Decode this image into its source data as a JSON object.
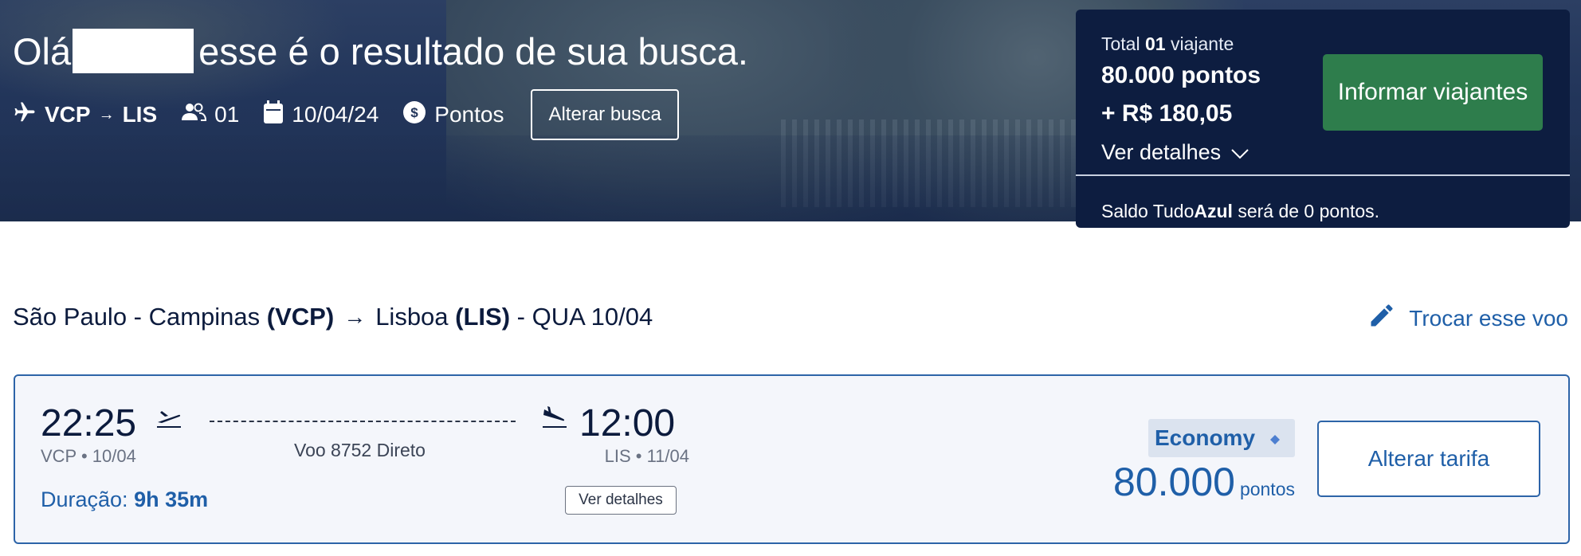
{
  "hero": {
    "greeting_prefix": "Olá",
    "greeting_suffix": "esse é o resultado de sua busca.",
    "origin": "VCP",
    "destination": "LIS",
    "passengers": "01",
    "date": "10/04/24",
    "payment_mode": "Pontos",
    "change_search_label": "Alterar busca"
  },
  "total_panel": {
    "label_prefix": "Total",
    "label_count": "01",
    "label_suffix": "viajante",
    "points_total": "80.000 pontos",
    "money_total": "+ R$ 180,05",
    "details_label": "Ver detalhes",
    "informar_label": "Informar viajantes",
    "saldo_prefix": "Saldo Tudo",
    "saldo_brand": "Azul",
    "saldo_suffix": "será de 0 pontos."
  },
  "route": {
    "origin_city": "São Paulo - Campinas",
    "origin_code": "(VCP)",
    "dest_city": "Lisboa",
    "dest_code": "(LIS)",
    "date_suffix": "- QUA 10/04",
    "swap_label": "Trocar esse voo"
  },
  "flight": {
    "departure_time": "22:25",
    "departure_meta": "VCP • 10/04",
    "arrival_time": "12:00",
    "arrival_meta": "LIS • 11/04",
    "flight_info": "Voo 8752 Direto",
    "duration_label": "Duração:",
    "duration_value": "9h 35m",
    "details_label": "Ver detalhes",
    "fare_class": "Economy",
    "price_value": "80.000",
    "price_unit": "pontos",
    "change_fare_label": "Alterar tarifa"
  },
  "colors": {
    "panel_bg": "#0d1d40",
    "primary_blue": "#1f5fa8",
    "cta_green": "#2e7d4c"
  },
  "icons": [
    "airplane-icon",
    "people-icon",
    "calendar-icon",
    "dollar-coin-icon",
    "chevron-down-icon",
    "pencil-icon",
    "takeoff-icon",
    "landing-icon",
    "diamond-icon"
  ]
}
